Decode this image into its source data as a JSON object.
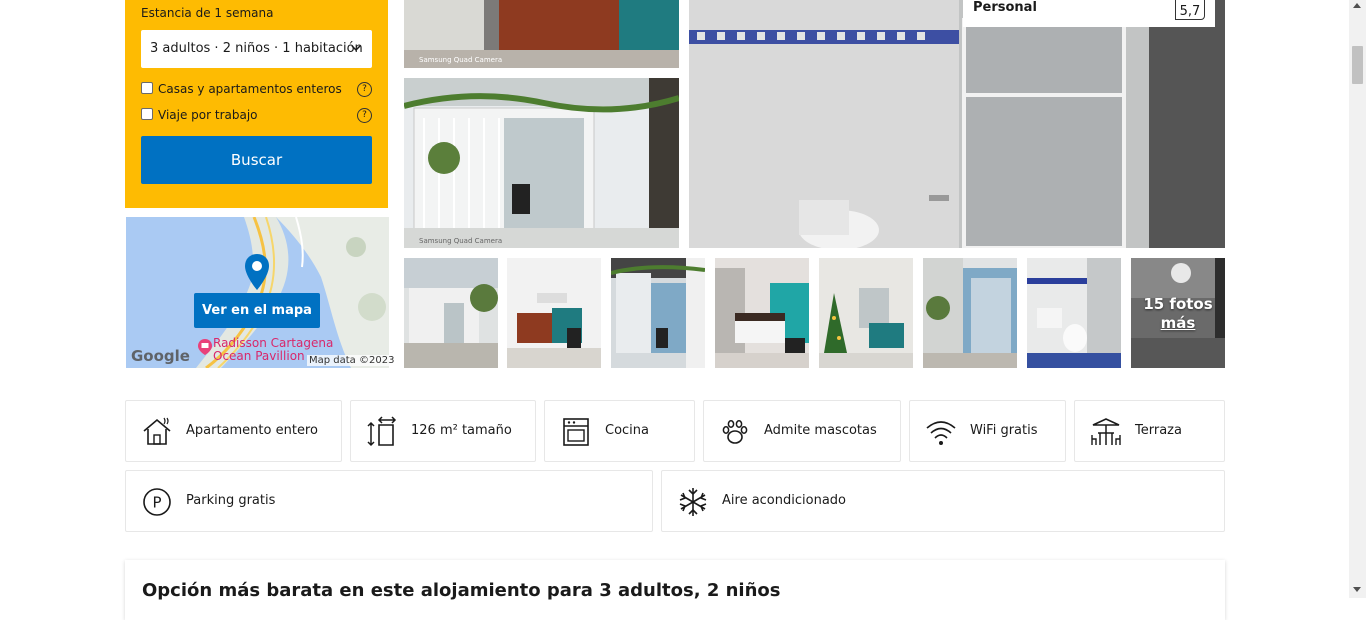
{
  "search": {
    "stay_label": "Estancia de 1 semana",
    "guests_value": "3 adultos · 2 niños · 1 habitación",
    "options": [
      {
        "label": "Casas y apartamentos enteros",
        "checked": false
      },
      {
        "label": "Viaje por trabajo",
        "checked": false
      }
    ],
    "help_symbol": "?",
    "button_label": "Buscar",
    "accent_color": "#febb02",
    "button_color": "#0071c2"
  },
  "map": {
    "button_label": "Ver en el mapa",
    "hotel_label_line1": "Radisson Cartagena",
    "hotel_label_line2": "Ocean Pavillion",
    "google": "Google",
    "credit": "Map data ©2023"
  },
  "gallery": {
    "more_photos_label_1": "15 fotos",
    "more_photos_label_2": "más",
    "watermark": "Samsung Quad Camera"
  },
  "review": {
    "category": "Personal",
    "score": "5,7"
  },
  "facilities": [
    {
      "label": "Apartamento entero",
      "icon": "house-icon"
    },
    {
      "label": "126 m² tamaño",
      "icon": "area-size-icon"
    },
    {
      "label": "Cocina",
      "icon": "kitchen-icon"
    },
    {
      "label": "Admite mascotas",
      "icon": "paw-icon"
    },
    {
      "label": "WiFi gratis",
      "icon": "wifi-icon"
    },
    {
      "label": "Terraza",
      "icon": "terrace-icon"
    },
    {
      "label": "Parking gratis",
      "icon": "parking-icon"
    },
    {
      "label": "Aire acondicionado",
      "icon": "snowflake-icon"
    }
  ],
  "cheapest": {
    "title": "Opción más barata en este alojamiento para 3 adultos, 2 niños"
  }
}
